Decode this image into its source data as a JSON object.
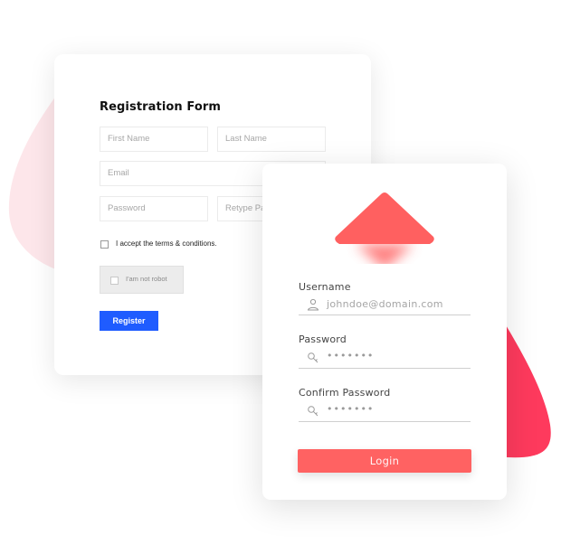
{
  "colors": {
    "blob_left": "#fde6ea",
    "blob_right": "#fe3a5d",
    "accent_login": "#ff6262",
    "accent_register": "#1f5cff"
  },
  "registration": {
    "title": "Registration Form",
    "fields": {
      "first_name": {
        "placeholder": "First Name"
      },
      "last_name": {
        "placeholder": "Last Name"
      },
      "email": {
        "placeholder": "Email"
      },
      "password": {
        "placeholder": "Password"
      },
      "retype_password": {
        "placeholder": "Retype Password"
      }
    },
    "terms_label": "I accept the terms & conditions.",
    "terms_checked": false,
    "captcha_label": "I'am not robot",
    "captcha_checked": false,
    "register_label": "Register"
  },
  "login": {
    "logo_icon": "diamond-logo-icon",
    "username": {
      "label": "Username",
      "value": "johndoe@domain.com",
      "icon": "user-icon"
    },
    "password": {
      "label": "Password",
      "value": "•••••••",
      "icon": "key-icon"
    },
    "confirm_password": {
      "label": "Confirm Password",
      "value": "•••••••",
      "icon": "key-icon"
    },
    "login_label": "Login"
  }
}
